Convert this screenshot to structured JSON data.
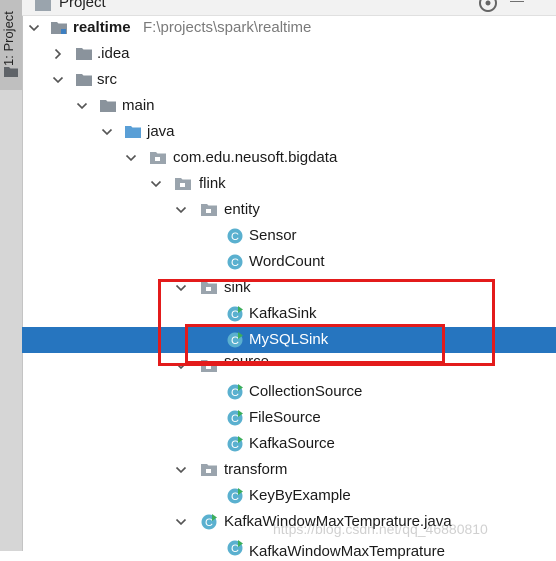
{
  "side_tab": {
    "label": "1: Project"
  },
  "header": {
    "title": "Project"
  },
  "project": {
    "name": "realtime",
    "path": "F:\\projects\\spark\\realtime"
  },
  "tree": {
    "idea": ".idea",
    "src": "src",
    "main": "main",
    "java": "java",
    "package": "com.edu.neusoft.bigdata",
    "flink": "flink",
    "entity": "entity",
    "sensor": "Sensor",
    "wordcount": "WordCount",
    "sink": "sink",
    "kafkasink": "KafkaSink",
    "mysqlsink": "MySQLSink",
    "source": "source",
    "collectionsource": "CollectionSource",
    "filesource": "FileSource",
    "kafkasource": "KafkaSource",
    "transform": "transform",
    "keybyexample": "KeyByExample",
    "kafkawindow": "KafkaWindowMaxTemprature.java",
    "kafkawindow_class": "KafkaWindowMaxTemprature"
  },
  "selected_item": "MySQLSink",
  "colors": {
    "selection": "#2675bf",
    "folder": "#8a939c",
    "package_folder": "#9aa4ad",
    "class_icon": "#5ab0cf",
    "highlight_box": "#e31b1b"
  },
  "watermark": "https://blog.csdn.net/qq_46880810"
}
